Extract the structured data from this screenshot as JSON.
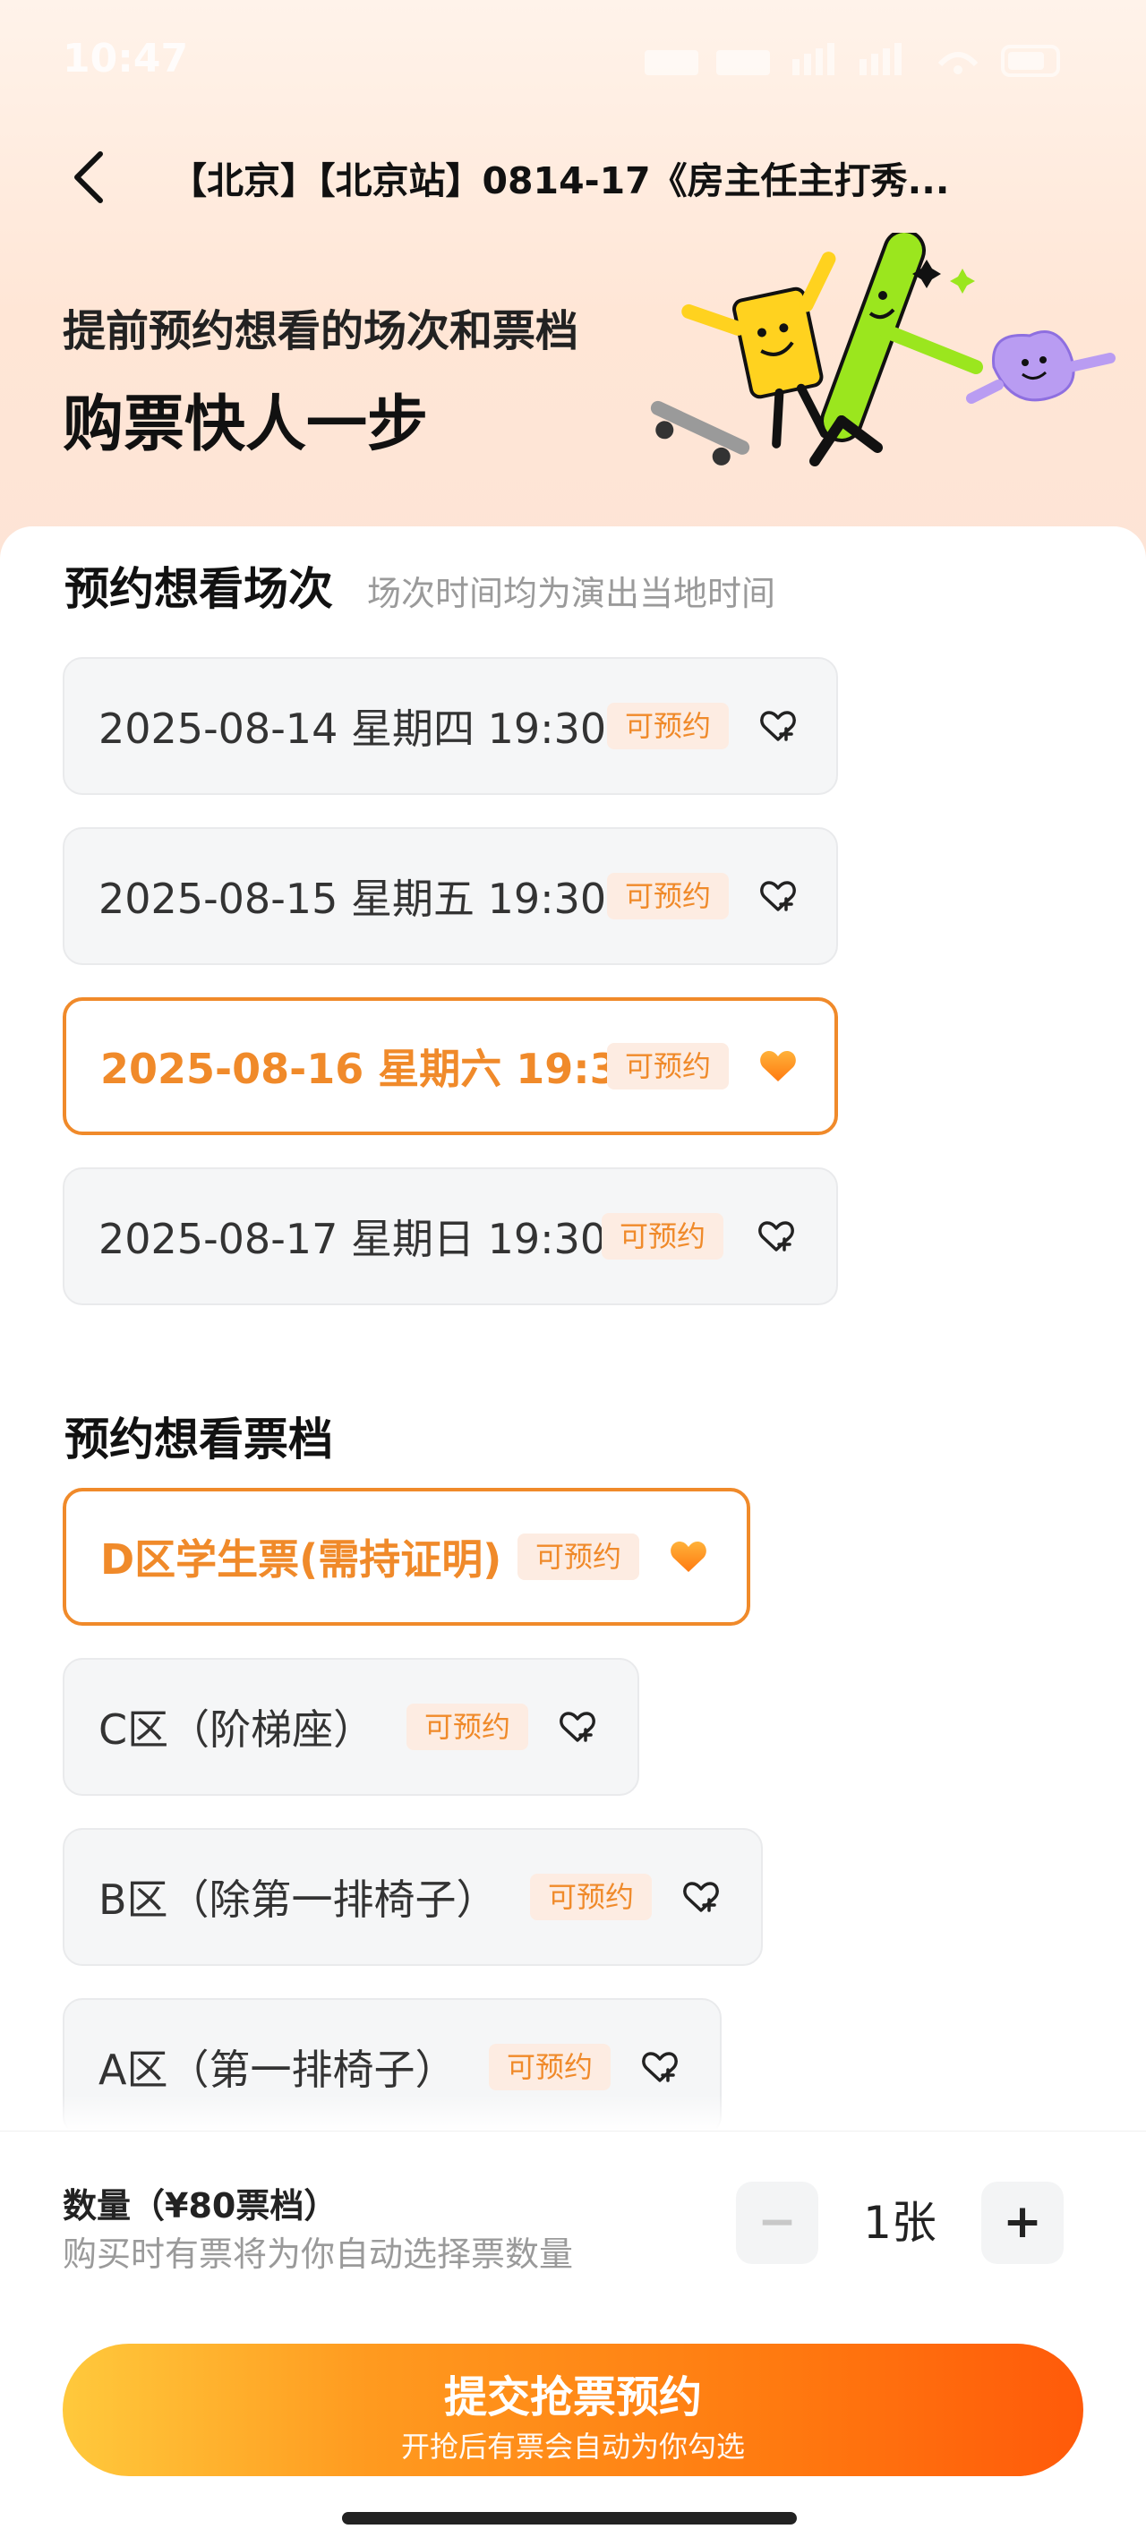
{
  "status_bar": {
    "time": "10:47"
  },
  "nav": {
    "title": "【北京】【北京站】0814-17《房主任主打秀..."
  },
  "hero": {
    "line1": "提前预约想看的场次和票档",
    "line2": "购票快人一步"
  },
  "sessions": {
    "title": "预约想看场次",
    "subtitle": "场次时间均为演出当地时间",
    "items": [
      {
        "label": "2025-08-14 星期四 19:30",
        "badge": "可预约",
        "selected": false
      },
      {
        "label": "2025-08-15 星期五 19:30",
        "badge": "可预约",
        "selected": false
      },
      {
        "label": "2025-08-16 星期六 19:30",
        "badge": "可预约",
        "selected": true
      },
      {
        "label": "2025-08-17 星期日 19:30",
        "badge": "可预约",
        "selected": false
      }
    ]
  },
  "tiers": {
    "title": "预约想看票档",
    "items": [
      {
        "label": "D区学生票(需持证明)",
        "badge": "可预约",
        "selected": true
      },
      {
        "label": "C区（阶梯座）",
        "badge": "可预约",
        "selected": false
      },
      {
        "label": "B区（除第一排椅子）",
        "badge": "可预约",
        "selected": false
      },
      {
        "label": "A区（第一排椅子）",
        "badge": "可预约",
        "selected": false
      }
    ]
  },
  "quantity": {
    "title": "数量（¥80票档）",
    "hint": "购买时有票将为你自动选择票数量",
    "value": "1张",
    "minus": "−",
    "plus": "+"
  },
  "submit": {
    "label": "提交抢票预约",
    "sublabel": "开抢后有票会自动为你勾选"
  },
  "colors": {
    "accent": "#f08a2a",
    "badge_bg": "#fdece2",
    "heart_fill": "#ff9a1f"
  }
}
